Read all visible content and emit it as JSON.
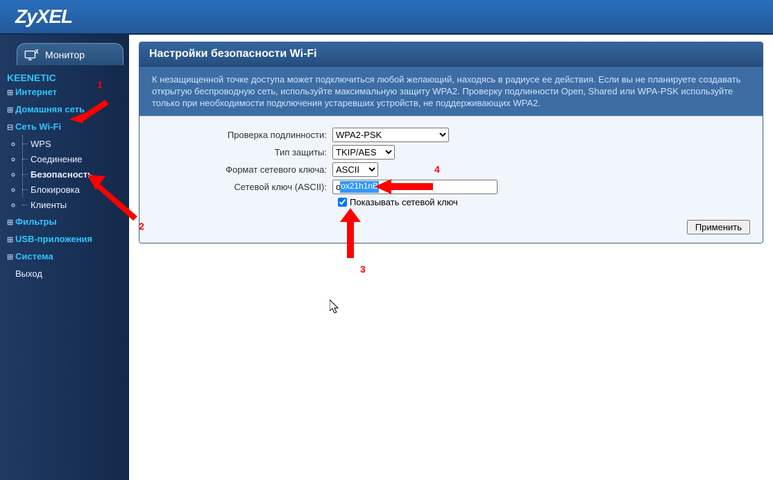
{
  "brand": "ZyXEL",
  "monitor_label": "Монитор",
  "root_title": "KEENETIC",
  "nav": {
    "internet": "Интернет",
    "home": "Домашняя сеть",
    "wifi": "Сеть Wi-Fi",
    "wifi_sub": {
      "wps": "WPS",
      "conn": "Соединение",
      "sec": "Безопасность",
      "block": "Блокировка",
      "clients": "Клиенты"
    },
    "filters": "Фильтры",
    "usb": "USB-приложения",
    "system": "Система",
    "exit": "Выход"
  },
  "panel": {
    "title": "Настройки безопасности Wi-Fi",
    "info": "К незащищенной точке доступа может подключиться любой желающий, находясь в радиусе ее действия. Если вы не планируете создавать открытую беспроводную сеть, используйте максимальную защиту WPA2. Проверку подлинности Open, Shared или WPA-PSK используйте только при необходимости подключения устаревших устройств, не поддерживающих WPA2."
  },
  "form": {
    "auth_label": "Проверка подлинности:",
    "auth_value": "WPA2-PSK",
    "prot_label": "Тип защиты:",
    "prot_value": "TKIP/AES",
    "keyfmt_label": "Формат сетевого ключа:",
    "keyfmt_value": "ASCII",
    "key_label": "Сетевой ключ (ASCII):",
    "key_value": "ox21h1nB",
    "showkey_label": "Показывать сетевой ключ",
    "apply": "Применить"
  },
  "ann": {
    "n1": "1",
    "n2": "2",
    "n3": "3",
    "n4": "4"
  }
}
